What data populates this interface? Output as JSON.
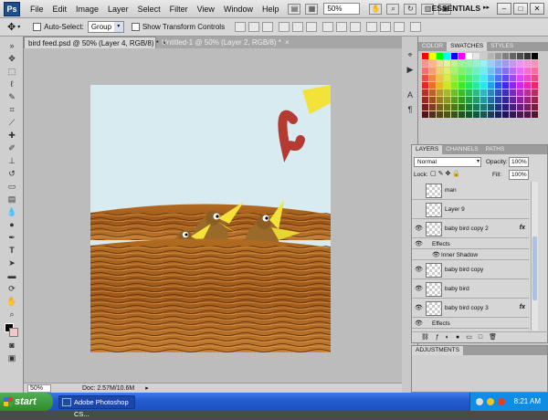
{
  "menubar": {
    "logo": "Ps",
    "items": [
      "File",
      "Edit",
      "Image",
      "Layer",
      "Select",
      "Filter",
      "View",
      "Window",
      "Help"
    ],
    "zoom": "50%",
    "workspace": "ESSENTIALS"
  },
  "options": {
    "auto_select_label": "Auto-Select:",
    "auto_select_value": "Group",
    "show_transform_label": "Show Transform Controls"
  },
  "tabs": [
    {
      "label": "bird feed.psd @ 50% (Layer 4, RGB/8) *",
      "close": "×"
    },
    {
      "label": "Untitled-1 @ 50% (Layer 2, RGB/8) *",
      "close": "×"
    }
  ],
  "status": {
    "zoom": "50%",
    "doc": "Doc: 2.57M/10.6M"
  },
  "swatches_panel": {
    "tabs": [
      "COLOR",
      "SWATCHES",
      "STYLES"
    ],
    "active": "SWATCHES"
  },
  "layers_panel": {
    "tabs": [
      "LAYERS",
      "CHANNELS",
      "PATHS"
    ],
    "blend_mode": "Normal",
    "opacity_label": "Opacity:",
    "opacity_value": "100%",
    "lock_label": "Lock:",
    "fill_label": "Fill:",
    "fill_value": "100%",
    "layers": [
      {
        "name": "man",
        "visible": false,
        "fx": ""
      },
      {
        "name": "Layer 9",
        "visible": false,
        "fx": ""
      },
      {
        "name": "baby bird copy 2",
        "visible": true,
        "fx": "fx"
      },
      {
        "name": "Effects",
        "sub": true
      },
      {
        "name": "Inner Shadow",
        "sub": true
      },
      {
        "name": "baby bird copy",
        "visible": true,
        "fx": ""
      },
      {
        "name": "baby bird",
        "visible": true,
        "fx": ""
      },
      {
        "name": "baby bird copy 3",
        "visible": true,
        "fx": "fx"
      },
      {
        "name": "Effects",
        "sub": true
      }
    ]
  },
  "adjustments_panel": {
    "title": "ADJUSTMENTS"
  },
  "taskbar": {
    "start": "start",
    "task": "Adobe Photoshop CS...",
    "clock": "8:21 AM"
  },
  "colors": {
    "sky": "#d8ebf1",
    "nest": "#a5601b",
    "bird_body": "#9a6a2a",
    "beak": "#f2e23a",
    "worm": "#b43a32"
  }
}
